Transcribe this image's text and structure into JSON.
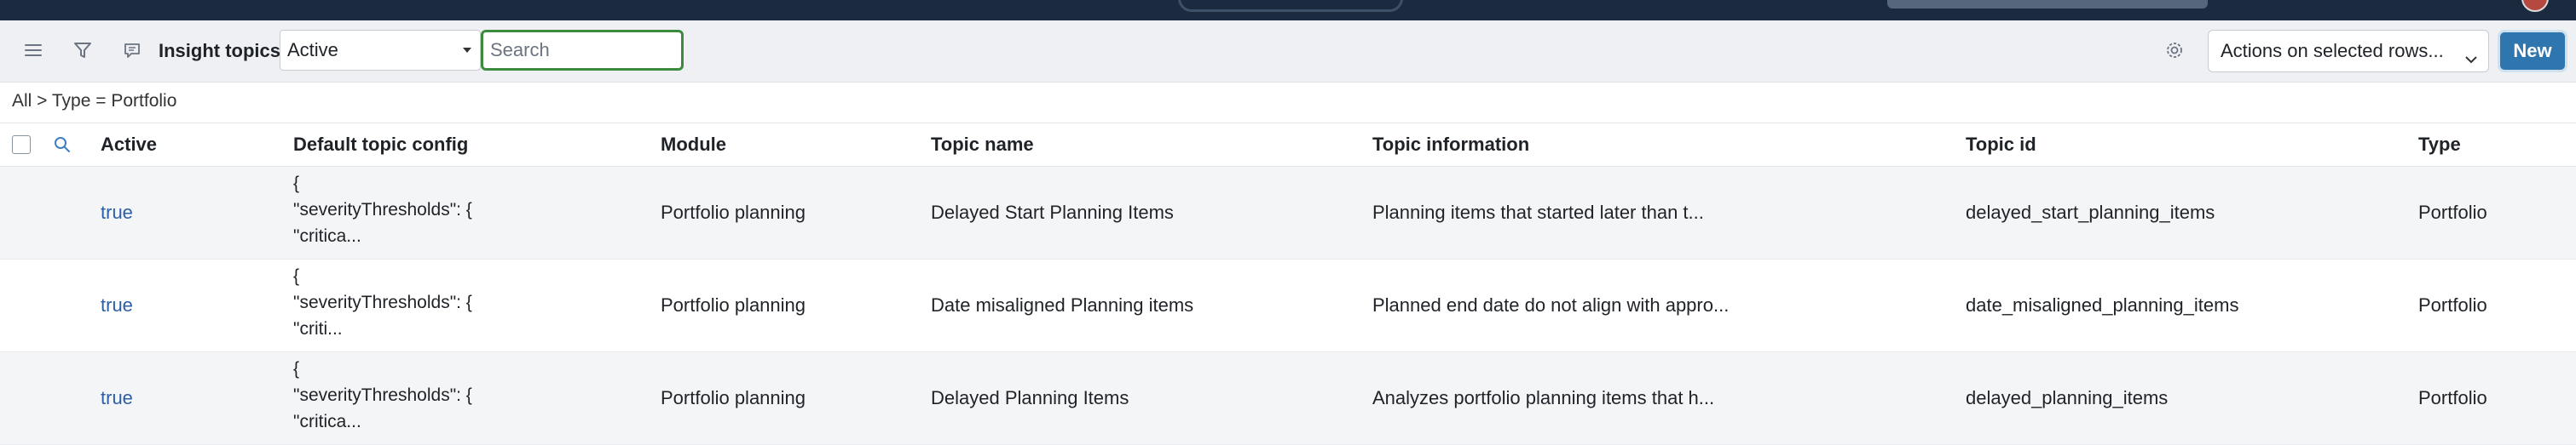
{
  "header": {
    "menu_icon": "hamburger-icon",
    "filter_icon": "funnel-icon",
    "chat_icon": "chat-bubble-icon",
    "title": "Insight topics",
    "filter_select_value": "Active",
    "search_placeholder": "Search",
    "settings_icon": "gear-icon",
    "actions_select_value": "Actions on selected rows...",
    "new_button_label": "New"
  },
  "breadcrumb": "All > Type = Portfolio",
  "table": {
    "columns": [
      "Active",
      "Default topic config",
      "Module",
      "Topic name",
      "Topic information",
      "Topic id",
      "Type"
    ],
    "rows": [
      {
        "active": "true",
        "config_1": "{",
        "config_2": "\"severityThresholds\": {",
        "config_3": "\"critica...",
        "module": "Portfolio planning",
        "name": "Delayed Start Planning Items",
        "info": "Planning items that started later than t...",
        "id": "delayed_start_planning_items",
        "type": "Portfolio"
      },
      {
        "active": "true",
        "config_1": "{",
        "config_2": "\"severityThresholds\": {",
        "config_3": "\"criti...",
        "module": "Portfolio planning",
        "name": "Date misaligned Planning items",
        "info": "Planned end date do not align with appro...",
        "id": "date_misaligned_planning_items",
        "type": "Portfolio"
      },
      {
        "active": "true",
        "config_1": "{",
        "config_2": "\"severityThresholds\": {",
        "config_3": "\"critica...",
        "module": "Portfolio planning",
        "name": "Delayed Planning Items",
        "info": "Analyzes portfolio planning items that h...",
        "id": "delayed_planning_items",
        "type": "Portfolio"
      }
    ]
  },
  "colors": {
    "appbar": "#1b2a3f",
    "toolbar": "#eef0f3",
    "search_focus": "#3b8a3e",
    "primary_button": "#2f75ae",
    "link": "#2b5fa8",
    "row_alt": "#f4f5f7"
  }
}
